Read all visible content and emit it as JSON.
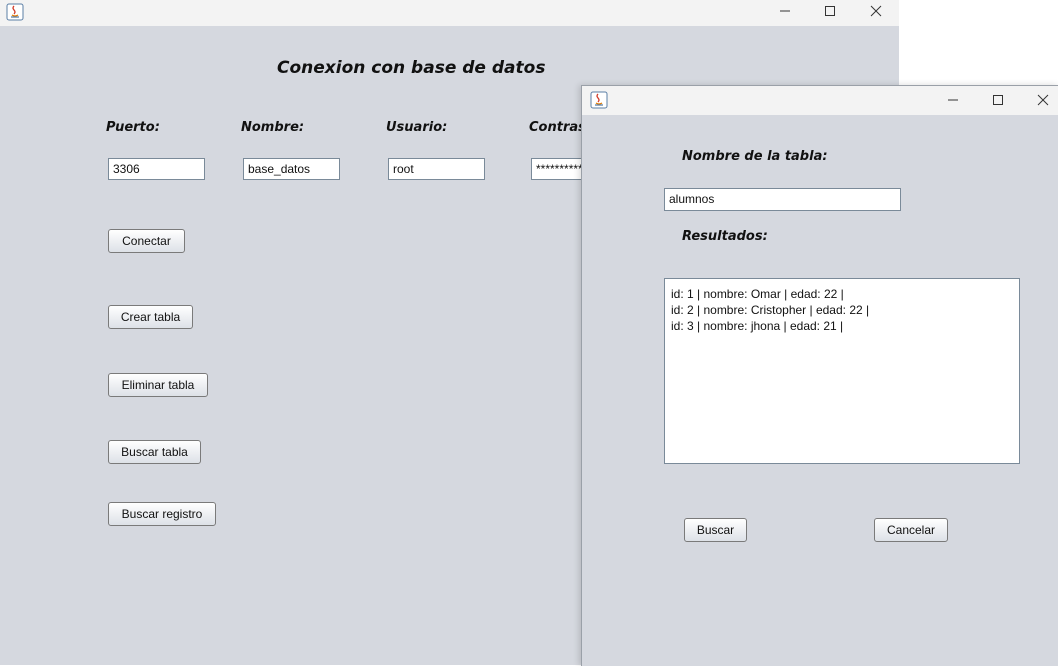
{
  "main_window": {
    "heading": "Conexion con base de datos",
    "labels": {
      "puerto": "Puerto:",
      "nombre": "Nombre:",
      "usuario": "Usuario:",
      "contrasena": "Contrase"
    },
    "fields": {
      "puerto": "3306",
      "nombre": "base_datos",
      "usuario": "root",
      "contrasena": "**********"
    },
    "buttons": {
      "conectar": "Conectar",
      "crear_tabla": "Crear tabla",
      "eliminar_tabla": "Eliminar tabla",
      "buscar_tabla": "Buscar tabla",
      "buscar_registro": "Buscar registro"
    }
  },
  "dialog": {
    "label_tabla": "Nombre de la tabla:",
    "tabla_value": "alumnos",
    "label_resultados": "Resultados:",
    "results": [
      "id: 1 | nombre: Omar | edad: 22 |",
      "id: 2 | nombre: Cristopher | edad: 22 |",
      "id: 3 | nombre: jhona | edad: 21 |"
    ],
    "buttons": {
      "buscar": "Buscar",
      "cancelar": "Cancelar"
    }
  },
  "icons": [
    "java-icon",
    "minimize-icon",
    "maximize-icon",
    "close-icon"
  ]
}
